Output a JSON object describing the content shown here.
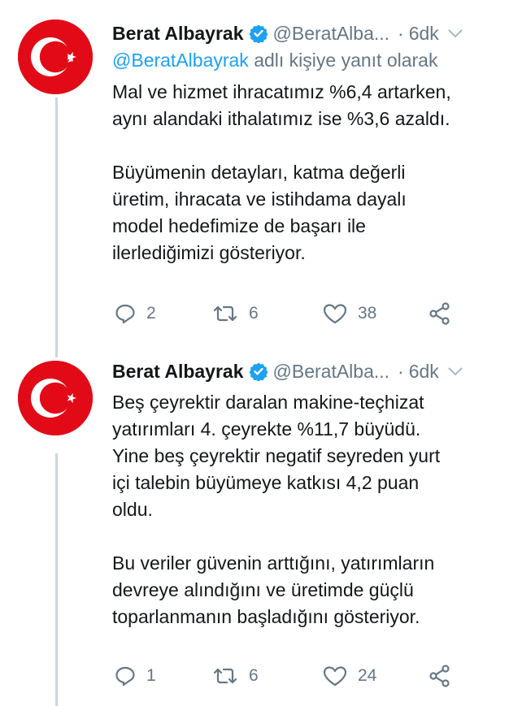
{
  "tweets": [
    {
      "author_name": "Berat Albayrak",
      "handle": "@BeratAlba...",
      "separator": "·",
      "time": "6dk",
      "reply_prefix": "@BeratAlbayrak",
      "reply_suffix": " adlı kişiye yanıt olarak",
      "paragraphs": [
        "Mal ve hizmet ihracatımız %6,4 artarken,\naynı alandaki ithalatımız ise %3,6 azaldı.",
        "Büyümenin detayları, katma değerli\nüretim, ihracata ve istihdama dayalı\nmodel hedefimize de başarı ile\nilerlediğimizi gösteriyor."
      ],
      "reply_count": "2",
      "retweet_count": "6",
      "like_count": "38"
    },
    {
      "author_name": "Berat Albayrak",
      "handle": "@BeratAlba...",
      "separator": "·",
      "time": "6dk",
      "paragraphs": [
        "Beş çeyrektir daralan makine-teçhizat\nyatırımları 4. çeyrekte %11,7 büyüdü.\nYine beş çeyrektir negatif seyreden yurt\niçi talebin büyümeye katkısı 4,2 puan\noldu.",
        "Bu veriler güvenin arttığını, yatırımların\ndevreye alındığını ve üretimde güçlü\ntoparlanmanın başladığını gösteriyor."
      ],
      "reply_count": "1",
      "retweet_count": "6",
      "like_count": "24"
    }
  ],
  "colors": {
    "flag_red": "#e30a17",
    "verified_blue": "#1da1f2",
    "mention_blue": "#1da1f2",
    "muted_gray": "#657786",
    "thread_line": "#ccd6dd"
  },
  "icons": [
    "turkish-flag-avatar",
    "verified-badge-icon",
    "chevron-down-icon",
    "reply-icon",
    "retweet-icon",
    "like-icon",
    "share-icon"
  ]
}
